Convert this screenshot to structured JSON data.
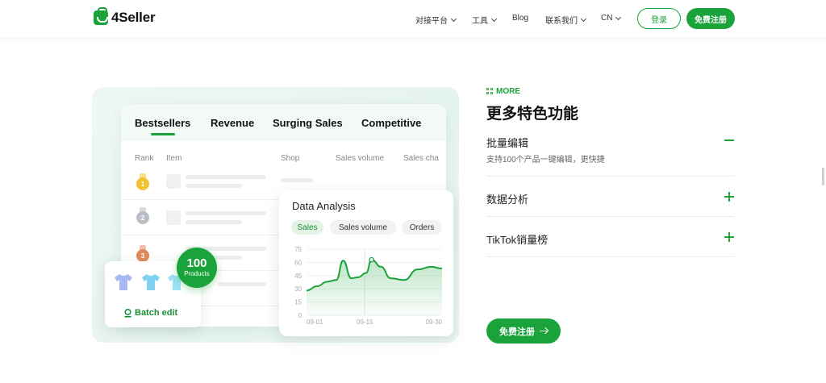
{
  "brand": {
    "name": "4Seller",
    "color": "#1aa33a"
  },
  "nav": {
    "items": [
      {
        "label": "对接平台",
        "has_dropdown": true
      },
      {
        "label": "工具",
        "has_dropdown": true
      },
      {
        "label": "Blog",
        "has_dropdown": false
      },
      {
        "label": "联系我们",
        "has_dropdown": true
      },
      {
        "label": "CN",
        "has_dropdown": true
      }
    ],
    "login_label": "登录",
    "signup_label": "免费注册"
  },
  "illustration": {
    "tabs": [
      "Bestsellers",
      "Revenue",
      "Surging Sales",
      "Competitive"
    ],
    "active_tab": "Bestsellers",
    "columns": [
      "Rank",
      "Item",
      "Shop",
      "Sales volume",
      "Sales cha"
    ],
    "ranks": [
      "1",
      "2",
      "3"
    ],
    "data_analysis": {
      "title": "Data Analysis",
      "chips": [
        "Sales",
        "Sales volume",
        "Orders"
      ],
      "active_chip": "Sales"
    },
    "batch_edit": {
      "badge_number": "100",
      "badge_label": "Products",
      "label": "Batch edit"
    }
  },
  "chart_data": {
    "type": "area",
    "title": "Data Analysis",
    "x": [
      "09-01",
      "09-15",
      "09-30"
    ],
    "xlabel": "",
    "ylabel": "",
    "yticks": [
      0,
      15,
      30,
      45,
      60,
      75
    ],
    "ylim": [
      0,
      75
    ],
    "series": [
      {
        "points": [
          [
            0,
            28
          ],
          [
            0.08,
            33
          ],
          [
            0.15,
            38
          ],
          [
            0.22,
            40
          ],
          [
            0.27,
            62
          ],
          [
            0.33,
            42
          ],
          [
            0.38,
            43
          ],
          [
            0.44,
            48
          ],
          [
            0.48,
            63
          ],
          [
            0.55,
            55
          ],
          [
            0.62,
            42
          ],
          [
            0.72,
            40
          ],
          [
            0.82,
            52
          ],
          [
            0.92,
            55
          ],
          [
            1.0,
            53
          ]
        ]
      }
    ],
    "grid": true
  },
  "features": {
    "tag": "MORE",
    "title": "更多特色功能",
    "items": [
      {
        "title": "批量编辑",
        "desc": "支持100个产品一键编辑，更快捷",
        "expanded": true
      },
      {
        "title": "数据分析",
        "desc": "",
        "expanded": false
      },
      {
        "title": "TikTok销量榜",
        "desc": "",
        "expanded": false
      }
    ],
    "cta_label": "免费注册"
  }
}
